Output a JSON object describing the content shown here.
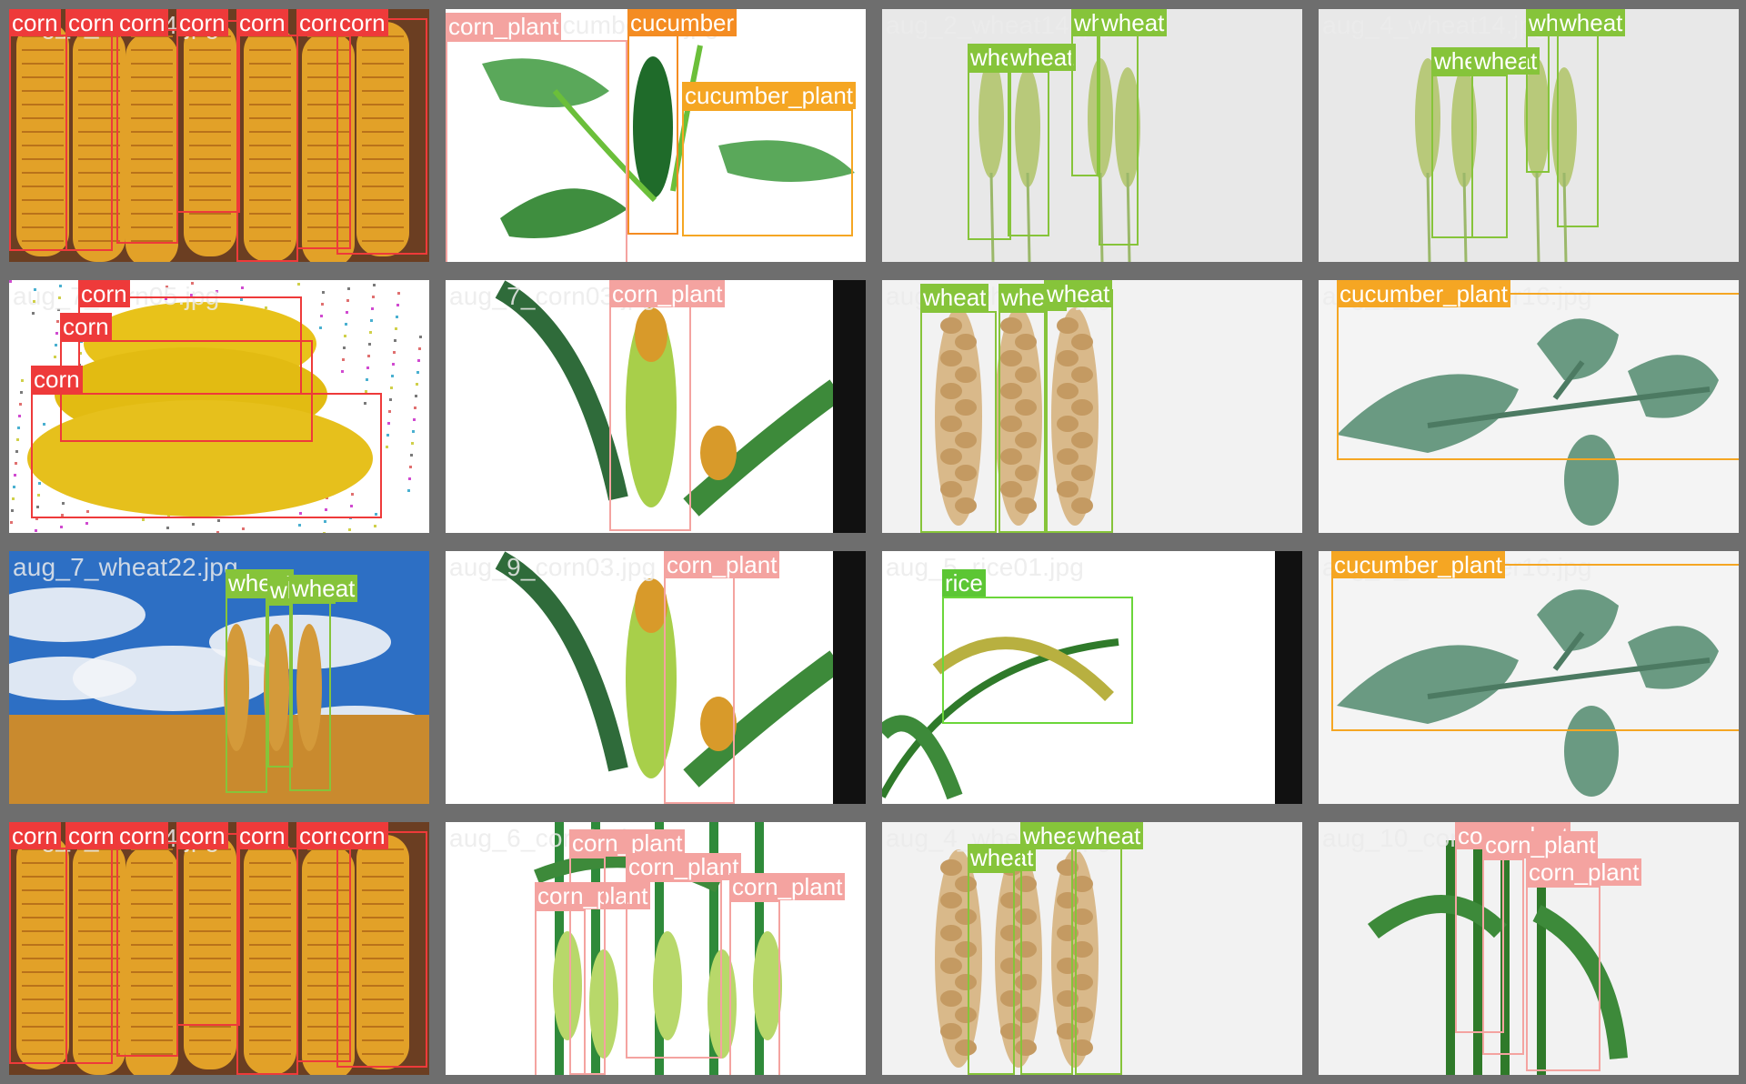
{
  "tiles": [
    {
      "filename": "aug_6_corn24.jpg",
      "scene": "corn-cobs"
    },
    {
      "filename": "aug_9_cucumber03.jpg",
      "scene": "cucumber"
    },
    {
      "filename": "aug_2_wheat14.jpg",
      "scene": "wheat-gray"
    },
    {
      "filename": "aug_4_wheat14.jpg",
      "scene": "wheat-gray"
    },
    {
      "filename": "aug_7_corn05.jpg",
      "scene": "corn-pile"
    },
    {
      "filename": "aug_7_corn03.jpg",
      "scene": "corn-plant"
    },
    {
      "filename": "aug_8_wheat15.jpg",
      "scene": "wheat-dry"
    },
    {
      "filename": "aug_2_cucumber16.jpg",
      "scene": "cucumber-leaf"
    },
    {
      "filename": "aug_7_wheat22.jpg",
      "scene": "wheat-sky"
    },
    {
      "filename": "aug_9_corn03.jpg",
      "scene": "corn-plant"
    },
    {
      "filename": "aug_5_rice01.jpg",
      "scene": "rice"
    },
    {
      "filename": "aug_9_cucumber16.jpg",
      "scene": "cucumber-leaf"
    },
    {
      "filename": "aug_2_corn24.jpg",
      "scene": "corn-cobs"
    },
    {
      "filename": "aug_6_corn01.jpg",
      "scene": "corn-stalks"
    },
    {
      "filename": "aug_4_wheat15.jpg",
      "scene": "wheat-dry"
    },
    {
      "filename": "aug_10_corn01.jpg",
      "scene": "corn-stalks-green"
    }
  ],
  "detections": [
    [
      {
        "label": "corn",
        "cls": "corn"
      },
      {
        "label": "corn",
        "cls": "corn"
      },
      {
        "label": "corn",
        "cls": "corn"
      },
      {
        "label": "corn",
        "cls": "corn"
      },
      {
        "label": "corn",
        "cls": "corn"
      },
      {
        "label": "corn",
        "cls": "corn"
      },
      {
        "label": "corn",
        "cls": "corn"
      }
    ],
    [
      {
        "label": "corn_plant",
        "cls": "cp"
      },
      {
        "label": "cucumber",
        "cls": "cuc"
      },
      {
        "label": "cucumber_plant",
        "cls": "cucp"
      }
    ],
    [
      {
        "label": "wheat",
        "cls": "wheat"
      },
      {
        "label": "wheat",
        "cls": "wheat"
      },
      {
        "label": "wheat",
        "cls": "wheat"
      },
      {
        "label": "wheat",
        "cls": "wheat"
      }
    ],
    [
      {
        "label": "wheat",
        "cls": "wheat"
      },
      {
        "label": "wheat",
        "cls": "wheat"
      },
      {
        "label": "wheat",
        "cls": "wheat"
      },
      {
        "label": "wheat",
        "cls": "wheat"
      }
    ],
    [
      {
        "label": "corn",
        "cls": "corn"
      },
      {
        "label": "corn",
        "cls": "corn"
      },
      {
        "label": "corn",
        "cls": "corn"
      }
    ],
    [
      {
        "label": "corn_plant",
        "cls": "cp"
      }
    ],
    [
      {
        "label": "wheat",
        "cls": "wheat"
      },
      {
        "label": "wheat",
        "cls": "wheat"
      },
      {
        "label": "wheat",
        "cls": "wheat"
      }
    ],
    [
      {
        "label": "cucumber_plant",
        "cls": "cucp"
      }
    ],
    [
      {
        "label": "wheat",
        "cls": "wheat"
      },
      {
        "label": "wheat",
        "cls": "wheat"
      },
      {
        "label": "wheat",
        "cls": "wheat"
      }
    ],
    [
      {
        "label": "corn_plant",
        "cls": "cp"
      }
    ],
    [
      {
        "label": "rice",
        "cls": "rice"
      }
    ],
    [
      {
        "label": "cucumber_plant",
        "cls": "cucp"
      }
    ],
    [
      {
        "label": "corn",
        "cls": "corn"
      },
      {
        "label": "corn",
        "cls": "corn"
      },
      {
        "label": "corn",
        "cls": "corn"
      },
      {
        "label": "corn",
        "cls": "corn"
      },
      {
        "label": "corn",
        "cls": "corn"
      },
      {
        "label": "corn",
        "cls": "corn"
      },
      {
        "label": "corn",
        "cls": "corn"
      }
    ],
    [
      {
        "label": "corn_plant",
        "cls": "cp"
      },
      {
        "label": "corn_plant",
        "cls": "cp"
      },
      {
        "label": "corn_plant",
        "cls": "cp"
      },
      {
        "label": "corn_plant",
        "cls": "cp"
      }
    ],
    [
      {
        "label": "wheat",
        "cls": "wheat"
      },
      {
        "label": "wheat",
        "cls": "wheat"
      },
      {
        "label": "wheat",
        "cls": "wheat"
      }
    ],
    [
      {
        "label": "corn_plant",
        "cls": "cp"
      },
      {
        "label": "corn_plant",
        "cls": "cp"
      },
      {
        "label": "corn_plant",
        "cls": "cp"
      }
    ]
  ],
  "colors": {
    "corn": "#ee3a3a",
    "corn_plant": "#f4a3a0",
    "cucumber": "#f48c22",
    "cucumber_plant": "#f5a623",
    "wheat": "#86c43a",
    "rice": "#5cc634",
    "separator": "#6e6e6e"
  }
}
